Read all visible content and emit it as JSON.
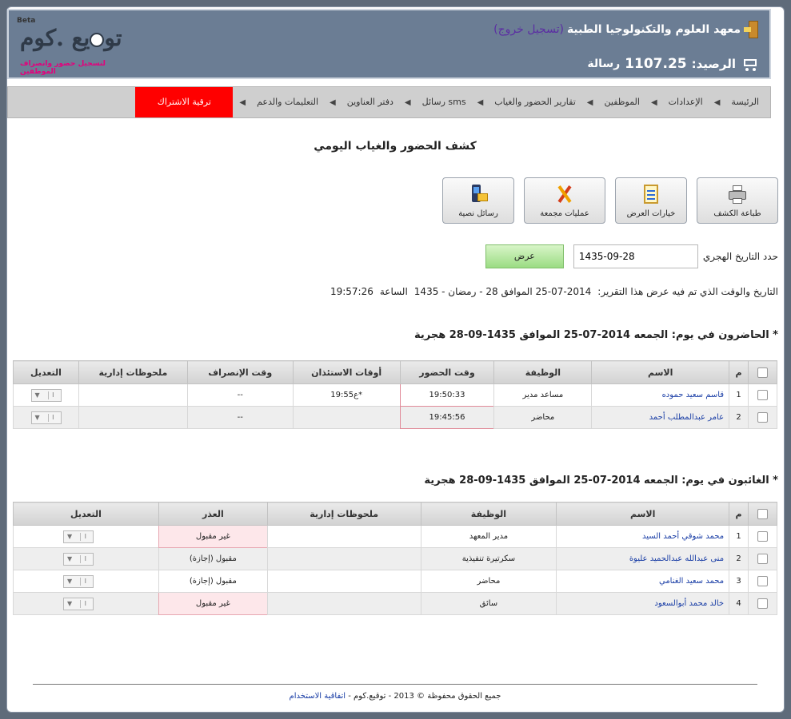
{
  "header": {
    "institution": "معهد العلوم والتكنولوجيا الطبية",
    "logout": "(تسجيل خروج)",
    "balance_label": "الرصيد:",
    "balance_value": "1107.25",
    "balance_unit": "رسالة",
    "logo_beta": "Beta",
    "logo_brand_1": "تو",
    "logo_brand_2": "يع .كوم",
    "logo_tagline": "لتسجيل حضور وانصراف الموظفين"
  },
  "nav": {
    "items": [
      "الرئيسة",
      "الإعدادات",
      "الموظفين",
      "تقارير الحضور والغياب",
      "رسائل sms",
      "دفتر العناوين",
      "التعليمات والدعم"
    ],
    "upgrade": "ترقية الاشتراك"
  },
  "page_title": "كشف الحضور والغياب اليومي",
  "toolbar": {
    "print": "طباعة الكشف",
    "display_options": "خيارات العرض",
    "bulk_ops": "عمليات مجمعة",
    "sms": "رسائل نصية"
  },
  "date_filter": {
    "label": "حدد التاريخ الهجري",
    "value": "1435-09-28",
    "button": "عرض"
  },
  "report_time": {
    "label": "التاريخ والوقت الذي تم فيه عرض هذا التقرير:",
    "date": "2014-07-25 الموافق 28 - رمضان - 1435",
    "time_label": "الساعة",
    "time": "19:57:26"
  },
  "present": {
    "title": "* الحاضرون في يوم: الجمعه 2014-07-25 الموافق 1435-09-28 هجرية",
    "headers": [
      "م",
      "الاسم",
      "الوظيفة",
      "وقت الحضور",
      "أوقات الاستئذان",
      "وقت الإنصراف",
      "ملحوظات إدارية",
      "التعديل"
    ],
    "rows": [
      {
        "num": "1",
        "name": "قاسم سعيد حموده",
        "job": "مساعد مدير",
        "arrive": "19:50:33",
        "permission": "*ع19:55",
        "leave": "--",
        "notes": ""
      },
      {
        "num": "2",
        "name": "عامر عبدالمطلب أحمد",
        "job": "محاضر",
        "arrive": "19:45:56",
        "permission": "",
        "leave": "--",
        "notes": ""
      }
    ]
  },
  "absent": {
    "title": "* الغائبون في يوم: الجمعه 2014-07-25 الموافق 1435-09-28 هجرية",
    "headers": [
      "م",
      "الاسم",
      "الوظيفة",
      "ملحوظات إدارية",
      "العذر",
      "التعديل"
    ],
    "rows": [
      {
        "num": "1",
        "name": "محمد شوقي أحمد السيد",
        "job": "مدير المعهد",
        "notes": "",
        "excuse": "غير مقبول"
      },
      {
        "num": "2",
        "name": "منى عبدالله عبدالحميد عليوة",
        "job": "سكرتيرة تنفيذية",
        "notes": "",
        "excuse": "مقبول (إجازة)"
      },
      {
        "num": "3",
        "name": "محمد سعيد الغنامي",
        "job": "محاضر",
        "notes": "",
        "excuse": "مقبول (إجازة)"
      },
      {
        "num": "4",
        "name": "خالد محمد أبوالسعود",
        "job": "سائق",
        "notes": "",
        "excuse": "غير مقبول"
      }
    ]
  },
  "edit_control": {
    "icon": "I",
    "text": "▼"
  },
  "footer": {
    "copyright": "جميع الحقوق محفوظة © 2013 - توقيع.كوم -",
    "terms": "اتفاقية الاستخدام"
  },
  "colors": {
    "header_bg": "#6b7d94",
    "upgrade_bg": "#ff0000",
    "show_button": "#9bdc83",
    "link": "#1a3ea6"
  }
}
